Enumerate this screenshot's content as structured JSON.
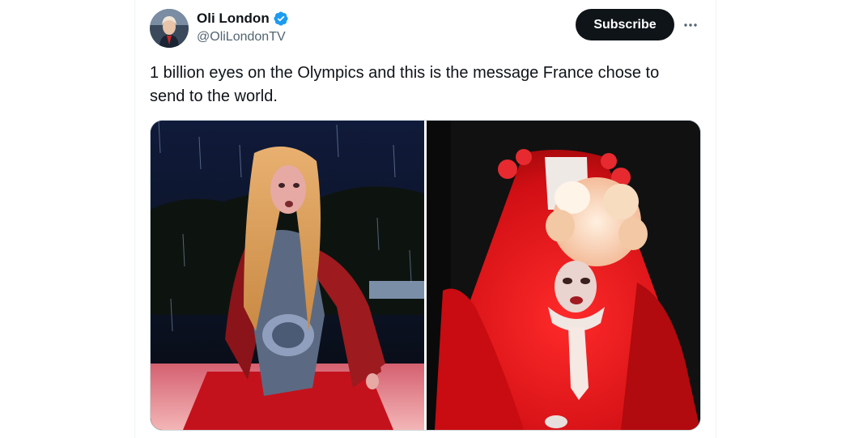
{
  "author": {
    "display_name": "Oli London",
    "handle": "@OliLondonTV",
    "verified": true
  },
  "actions": {
    "subscribe_label": "Subscribe",
    "more_icon": "more-horizontal-icon"
  },
  "post": {
    "text": "1 billion eyes on the Olympics and this is the message France chose to send to the world."
  },
  "media": {
    "count": 2
  },
  "colors": {
    "text_primary": "#0f1419",
    "text_secondary": "#536471",
    "verified_blue": "#1d9bf0",
    "button_dark": "#0f1419"
  }
}
